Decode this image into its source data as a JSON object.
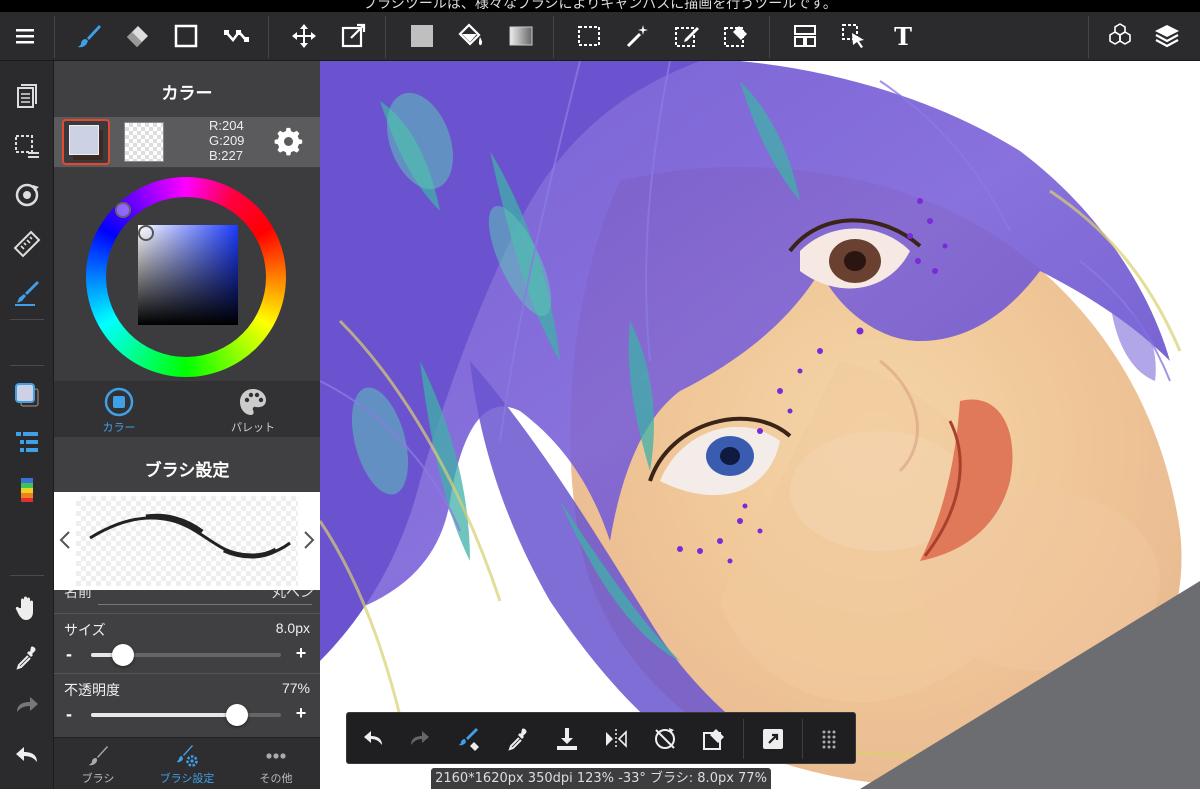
{
  "hint_text": "ブラシツールは、様々なブラシによりキャンバスに描画を行うツールです。",
  "color_panel": {
    "title": "カラー",
    "rgb": {
      "r": "R:204",
      "g": "G:209",
      "b": "B:227"
    },
    "main_color": "#ccd1e3",
    "sub_color": "#3b2a23",
    "tabs": [
      {
        "label": "カラー",
        "active": true
      },
      {
        "label": "パレット",
        "active": false
      }
    ]
  },
  "brush_panel": {
    "title": "ブラシ設定",
    "partial_row": {
      "label": "名前",
      "value": "丸ペン"
    },
    "size": {
      "label": "サイズ",
      "value": "8.0px",
      "level": 0.17
    },
    "opacity": {
      "label": "不透明度",
      "value": "77%",
      "level": 0.77
    },
    "minus": "-",
    "plus": "+"
  },
  "bottom_tabs": [
    {
      "label": "ブラシ",
      "active": false
    },
    {
      "label": "ブラシ設定",
      "active": true
    },
    {
      "label": "その他",
      "active": false
    }
  ],
  "toolbar_text_tool": "T",
  "status_text": "2160*1620px 350dpi 123% -33° ブラシ: 8.0px 77%",
  "colors": {
    "accent": "#3fa0e8",
    "active_border": "#e14a2f",
    "panel": "#404043",
    "bar": "#2b2b2d"
  }
}
